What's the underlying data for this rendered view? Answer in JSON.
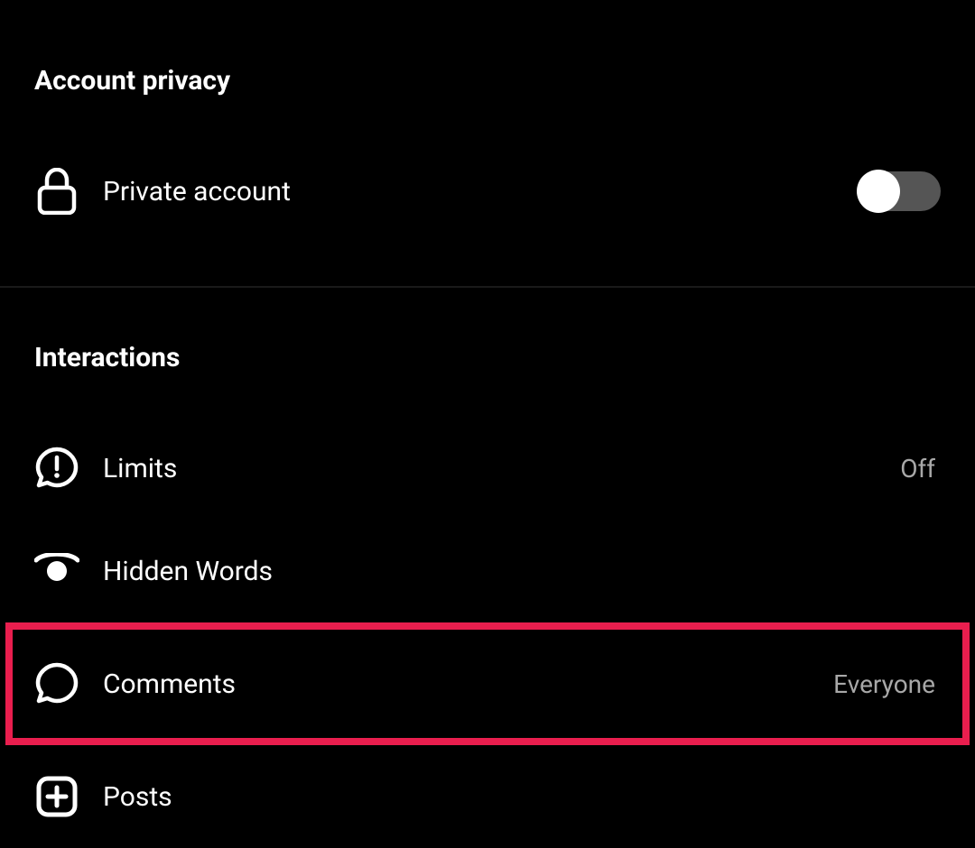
{
  "sections": {
    "account_privacy": {
      "header": "Account privacy",
      "private_account": {
        "label": "Private account",
        "enabled": false
      }
    },
    "interactions": {
      "header": "Interactions",
      "limits": {
        "label": "Limits",
        "value": "Off"
      },
      "hidden_words": {
        "label": "Hidden Words"
      },
      "comments": {
        "label": "Comments",
        "value": "Everyone"
      },
      "posts": {
        "label": "Posts"
      }
    }
  }
}
